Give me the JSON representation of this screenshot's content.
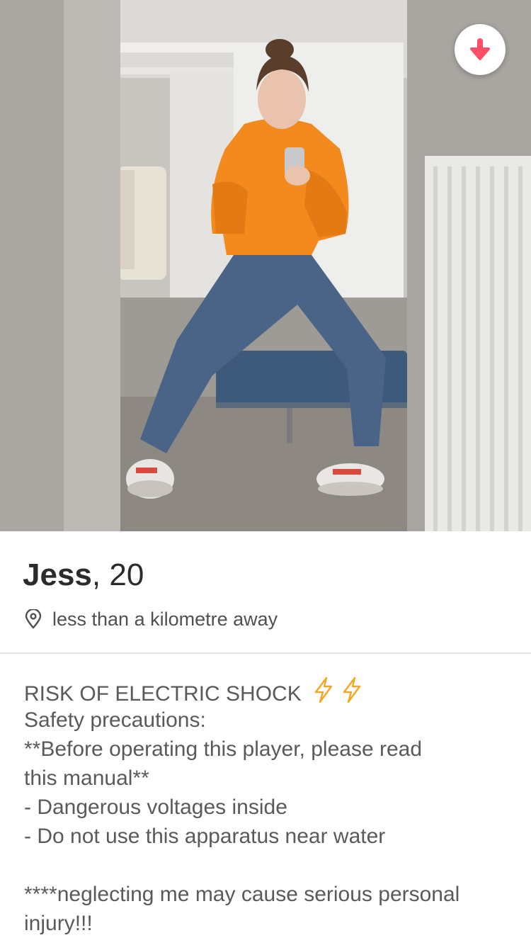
{
  "profile": {
    "name": "Jess",
    "separator": ",",
    "age": "20",
    "distance": "less than a kilometre away"
  },
  "bio": {
    "line1": "RISK OF ELECTRIC SHOCK",
    "line1_emoji": "⚡⚡",
    "line2": "Safety precautions:",
    "line3": "**Before operating this player, please read",
    "line4": "this manual**",
    "line5": "- Dangerous voltages inside",
    "line6": "- Do not use this apparatus near water",
    "line7": "****neglecting me may cause serious personal",
    "line8": "injury!!!"
  },
  "icons": {
    "collapse": "arrow-down-icon",
    "location": "location-pin-icon",
    "bolt": "lightning-bolt-icon"
  },
  "colors": {
    "accent": "#fd5068",
    "bolt": "#f5a623",
    "hoodie": "#f28a1e",
    "jeans": "#4a6487",
    "bench": "#3e5a7a"
  }
}
